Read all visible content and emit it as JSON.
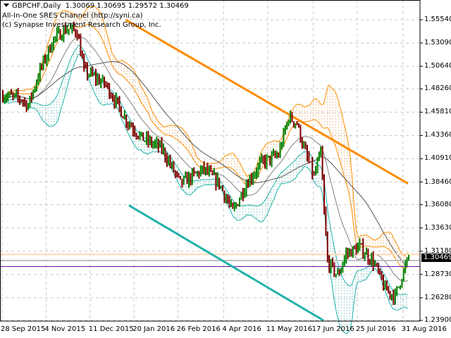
{
  "header": {
    "symbol": "GBPCHF,Daily",
    "ohlc": "1.30069 1.30695 1.29572 1.30469",
    "indicator_name": "All-In-One SRES Channel (http://syni.ca)",
    "copyright": "(c) Synapse Investment Research Group, Inc."
  },
  "chart_data": {
    "type": "bar",
    "symbol": "GBPCHF",
    "timeframe": "Daily",
    "ylim": [
      1.239,
      1.5554
    ],
    "y_ticks": [
      "1.55540",
      "1.53090",
      "1.50640",
      "1.48260",
      "1.45810",
      "1.43360",
      "1.40910",
      "1.38460",
      "1.36080",
      "1.33630",
      "1.31180",
      "1.28730",
      "1.26280",
      "1.23900"
    ],
    "x_ticks": [
      {
        "bar": 0,
        "label": "28 Sep 2015"
      },
      {
        "bar": 26,
        "label": "4 Nov 2015"
      },
      {
        "bar": 52,
        "label": "11 Dec 2015"
      },
      {
        "bar": 78,
        "label": "20 Jan 2016"
      },
      {
        "bar": 104,
        "label": "26 Feb 2016"
      },
      {
        "bar": 131,
        "label": "4 Apr 2016"
      },
      {
        "bar": 157,
        "label": "11 May 2016"
      },
      {
        "bar": 184,
        "label": "17 Jun 2016"
      },
      {
        "bar": 210,
        "label": "25 Jul 2016"
      },
      {
        "bar": 237,
        "label": "31 Aug 2016"
      }
    ],
    "bar_count": 241,
    "close_path": [
      [
        0,
        1.476
      ],
      [
        11,
        1.472
      ],
      [
        15,
        1.465
      ],
      [
        22,
        1.502
      ],
      [
        30,
        1.535
      ],
      [
        38,
        1.546
      ],
      [
        44,
        1.543
      ],
      [
        48,
        1.502
      ],
      [
        61,
        1.487
      ],
      [
        73,
        1.45
      ],
      [
        82,
        1.431
      ],
      [
        94,
        1.42
      ],
      [
        105,
        1.383
      ],
      [
        119,
        1.398
      ],
      [
        128,
        1.383
      ],
      [
        136,
        1.353
      ],
      [
        144,
        1.383
      ],
      [
        153,
        1.405
      ],
      [
        163,
        1.413
      ],
      [
        169,
        1.453
      ],
      [
        174,
        1.446
      ],
      [
        178,
        1.42
      ],
      [
        184,
        1.39
      ],
      [
        188,
        1.416
      ],
      [
        190,
        1.353
      ],
      [
        192,
        1.301
      ],
      [
        198,
        1.286
      ],
      [
        203,
        1.309
      ],
      [
        211,
        1.316
      ],
      [
        219,
        1.301
      ],
      [
        226,
        1.272
      ],
      [
        232,
        1.264
      ],
      [
        236,
        1.286
      ],
      [
        240,
        1.3047
      ]
    ],
    "last_price": "1.30469",
    "horizontal_levels": [
      {
        "price": 1.3085,
        "color": "#ffd8b0"
      },
      {
        "price": 1.302,
        "color": "#c0c0c0"
      },
      {
        "price": 1.2957,
        "color": "#6a0dad"
      }
    ],
    "trend_lines": [
      {
        "from": [
          73,
          1.5554
        ],
        "to": [
          240,
          1.383
        ],
        "color": "#ff8c00"
      },
      {
        "from": [
          75,
          1.36
        ],
        "to": [
          190,
          1.239
        ],
        "color": "#20b2aa"
      }
    ],
    "colors": {
      "up": "#008000",
      "down": "#800000",
      "upper_band": "#ff8c00",
      "lower_band": "#20b2aa",
      "middle": "#808080"
    }
  }
}
